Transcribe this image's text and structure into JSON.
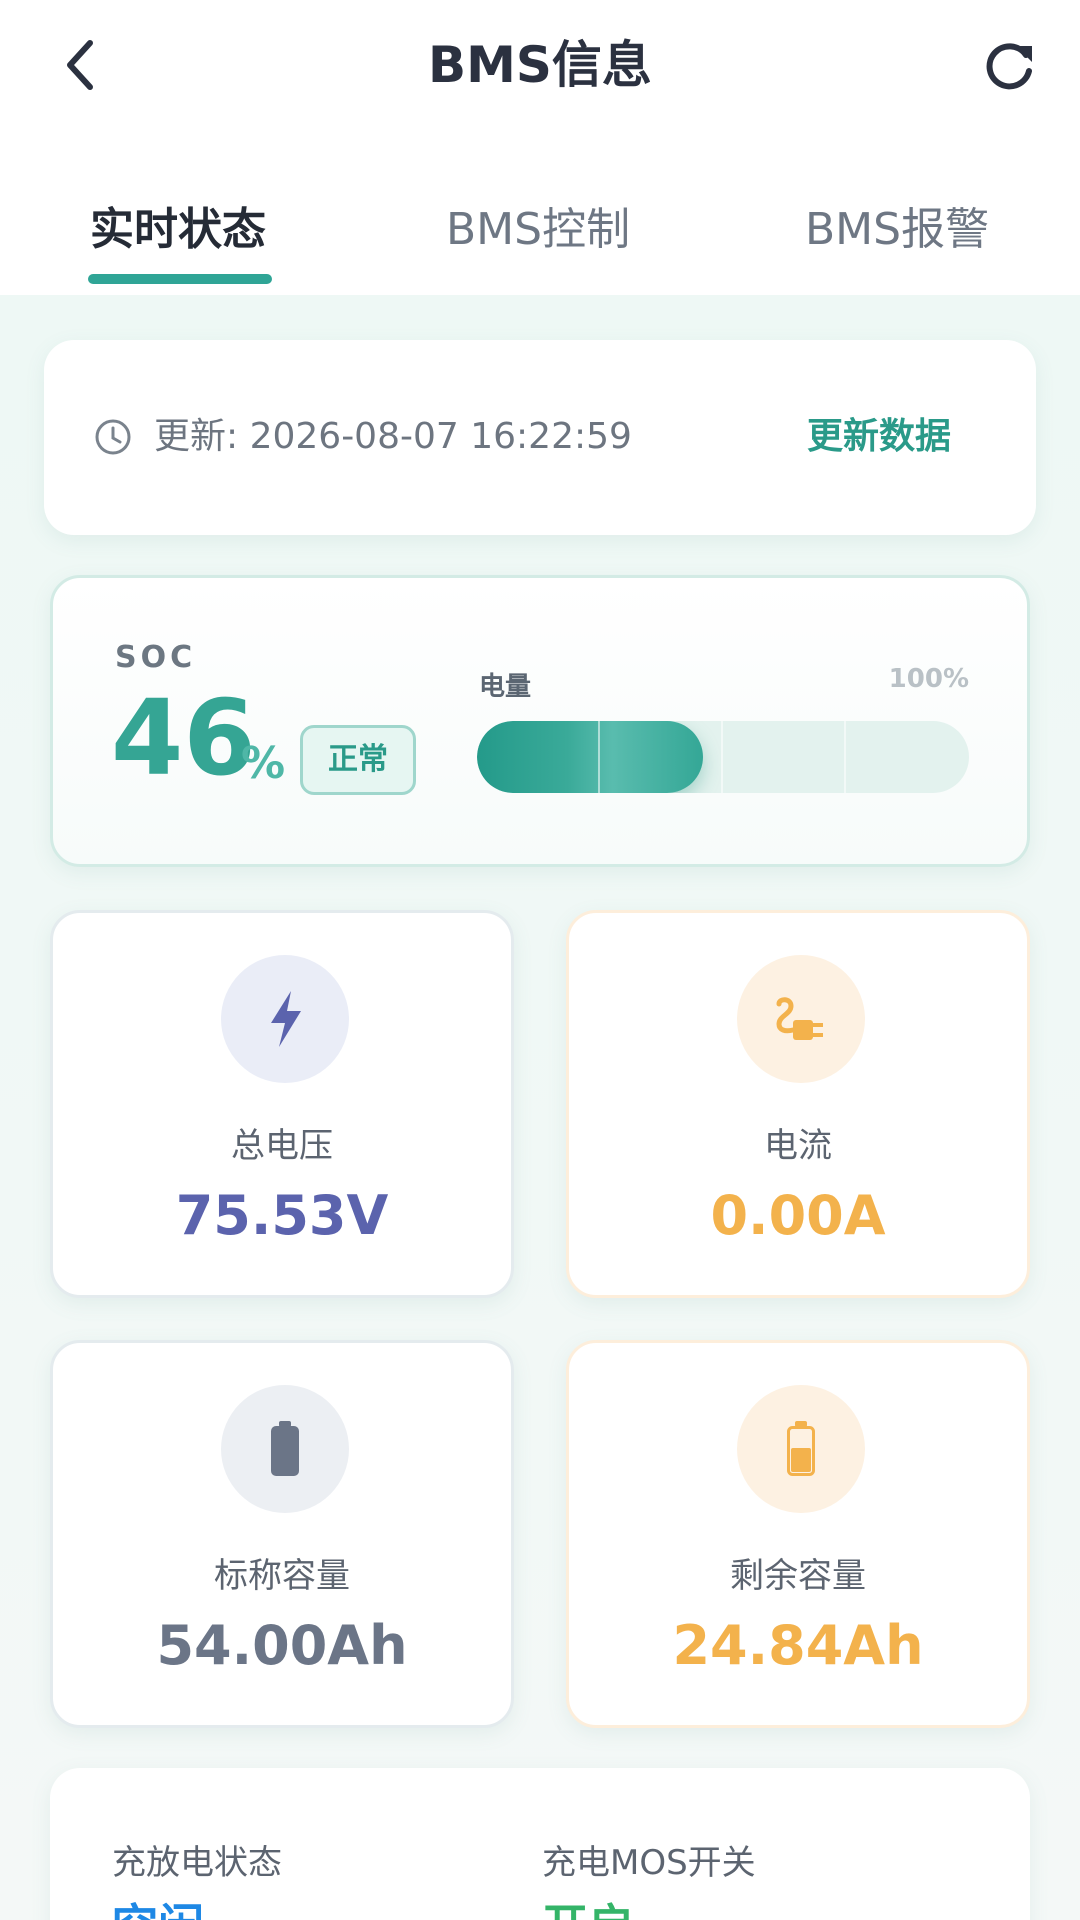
{
  "header": {
    "title": "BMS信息",
    "back_icon": "chevron-left-icon",
    "refresh_icon": "refresh-icon"
  },
  "tabs": [
    {
      "label": "实时状态",
      "active": true
    },
    {
      "label": "BMS控制",
      "active": false
    },
    {
      "label": "BMS报警",
      "active": false
    }
  ],
  "update": {
    "icon": "clock-icon",
    "text": "更新: 2026-08-07 16:22:59",
    "button_label": "更新数据"
  },
  "soc": {
    "label": "SOC",
    "value": "46",
    "unit": "%",
    "status": "正常",
    "bar_label": "电量",
    "bar_max": "100%",
    "level": 0.46
  },
  "metrics": [
    {
      "label": "总电压",
      "value": "75.53V",
      "icon": "lightning-icon",
      "color": "#5b63ad",
      "icon_bg": "#eaedf7"
    },
    {
      "label": "电流",
      "value": "0.00A",
      "icon": "plug-icon",
      "color": "#f3b24c",
      "icon_bg": "#fdf1e2"
    },
    {
      "label": "标称容量",
      "value": "54.00Ah",
      "icon": "battery-icon",
      "color": "#6b7587",
      "icon_bg": "#eceff3"
    },
    {
      "label": "剩余容量",
      "value": "24.84Ah",
      "icon": "battery-half-icon",
      "color": "#f3b24c",
      "icon_bg": "#fdf1e2"
    }
  ],
  "status": [
    {
      "label": "充放电状态",
      "value": "空闲",
      "color": "#1e88e5"
    },
    {
      "label": "充电MOS开关",
      "value": "开启",
      "color": "#34b468"
    }
  ],
  "colors": {
    "accent": "#2fa596",
    "background": "#eef8f5"
  }
}
